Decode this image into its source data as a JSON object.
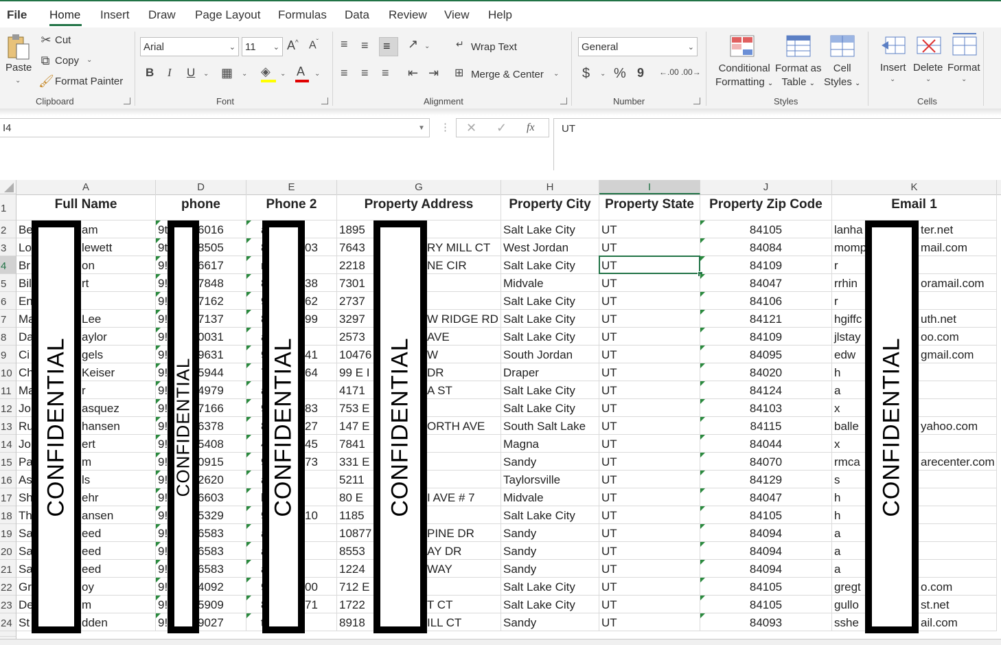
{
  "tabs": [
    "File",
    "Home",
    "Insert",
    "Draw",
    "Page Layout",
    "Formulas",
    "Data",
    "Review",
    "View",
    "Help"
  ],
  "ribbon": {
    "clipboard": {
      "paste": "Paste",
      "cut": "Cut",
      "copy": "Copy",
      "format_painter": "Format Painter",
      "label": "Clipboard"
    },
    "font": {
      "name": "Arial",
      "size": "11",
      "label": "Font",
      "bold": "B",
      "italic": "I",
      "underline": "U",
      "grow": "A",
      "shrink": "A"
    },
    "alignment": {
      "wrap_text": "Wrap Text",
      "merge_center": "Merge & Center",
      "label": "Alignment"
    },
    "number": {
      "format": "General",
      "label": "Number",
      "currency": "$",
      "percent": "%",
      "comma": "9",
      "inc_decimal": ".00",
      "dec_decimal": ".00"
    },
    "styles": {
      "conditional_formatting": [
        "Conditional",
        "Formatting"
      ],
      "format_as_table": [
        "Format as",
        "Table"
      ],
      "cell_styles": [
        "Cell",
        "Styles"
      ],
      "label": "Styles"
    },
    "cells": {
      "insert": "Insert",
      "delete": "Delete",
      "format": "Format",
      "label": "Cells"
    }
  },
  "formula_bar": {
    "name_box": "I4",
    "fx": "fx",
    "value": "UT"
  },
  "columns": [
    "A",
    "D",
    "E",
    "G",
    "H",
    "I",
    "J",
    "K"
  ],
  "selected_column": "I",
  "selected_row": "4",
  "headers": [
    "Full Name",
    "phone",
    "Phone 2",
    "Property Address",
    "Property City",
    "Property State",
    "Property Zip Code",
    "Email 1"
  ],
  "rows": [
    {
      "n": "2",
      "a1": "Be",
      "a2": "am",
      "d1": "9t",
      "d2": "6016",
      "e1": "a",
      "e2": "",
      "g1": "1895",
      "g2": "",
      "city": "Salt Lake City",
      "state": "UT",
      "zip": "84105",
      "k1": "lanha",
      "k2": "ter.net"
    },
    {
      "n": "3",
      "a1": "Lo",
      "a2": "lewett",
      "d1": "9t",
      "d2": "8505",
      "e1": "80",
      "e2": "03",
      "g1": "7643",
      "g2": "RY MILL CT",
      "city": "West Jordan",
      "state": "UT",
      "zip": "84084",
      "k1": "momp",
      "k2": "mail.com"
    },
    {
      "n": "4",
      "a1": "Br",
      "a2": "on",
      "d1": "9!",
      "d2": "6617",
      "e1": "r",
      "e2": "",
      "g1": "2218",
      "g2": "NE CIR",
      "city": "Salt Lake City",
      "state": "UT",
      "zip": "84109",
      "k1": "r",
      "k2": ""
    },
    {
      "n": "5",
      "a1": "Bil",
      "a2": "rt",
      "d1": "9!",
      "d2": "7848",
      "e1": "80",
      "e2": "38",
      "g1": "7301",
      "g2": "",
      "city": "Midvale",
      "state": "UT",
      "zip": "84047",
      "k1": "rrhin",
      "k2": "oramail.com"
    },
    {
      "n": "6",
      "a1": "En",
      "a2": "",
      "d1": "9!",
      "d2": "7162",
      "e1": "97",
      "e2": "62",
      "g1": "2737",
      "g2": "",
      "city": "Salt Lake City",
      "state": "UT",
      "zip": "84106",
      "k1": "r",
      "k2": ""
    },
    {
      "n": "7",
      "a1": "Ma",
      "a2": "Lee",
      "d1": "9!",
      "d2": "7137",
      "e1": "81",
      "e2": "99",
      "g1": "3297",
      "g2": "W RIDGE RD",
      "city": "Salt Lake City",
      "state": "UT",
      "zip": "84121",
      "k1": "hgiffc",
      "k2": "uth.net"
    },
    {
      "n": "8",
      "a1": "Da",
      "a2": "aylor",
      "d1": "9!",
      "d2": "0031",
      "e1": "a",
      "e2": "",
      "g1": "2573",
      "g2": "AVE",
      "city": "Salt Lake City",
      "state": "UT",
      "zip": "84109",
      "k1": "jlstay",
      "k2": "oo.com"
    },
    {
      "n": "9",
      "a1": "Ci",
      "a2": "gels",
      "d1": "9!",
      "d2": "9631",
      "e1": "97",
      "e2": "41",
      "g1": "10476",
      "g2": "W",
      "city": "South Jordan",
      "state": "UT",
      "zip": "84095",
      "k1": "edw",
      "k2": "gmail.com"
    },
    {
      "n": "10",
      "a1": "Ch",
      "a2": "Keiser",
      "d1": "9!",
      "d2": "5944",
      "e1": "75",
      "e2": "64",
      "g1": "99 E I",
      "g2": "DR",
      "city": "Draper",
      "state": "UT",
      "zip": "84020",
      "k1": "h",
      "k2": ""
    },
    {
      "n": "11",
      "a1": "Ma",
      "a2": "r",
      "d1": "9!",
      "d2": "4979",
      "e1": "a",
      "e2": "",
      "g1": "4171",
      "g2": "A ST",
      "city": "Salt Lake City",
      "state": "UT",
      "zip": "84124",
      "k1": "a",
      "k2": ""
    },
    {
      "n": "12",
      "a1": "Jo",
      "a2": "asquez",
      "d1": "9!",
      "d2": "7166",
      "e1": "94",
      "e2": "83",
      "g1": "753 E",
      "g2": "",
      "city": "Salt Lake City",
      "state": "UT",
      "zip": "84103",
      "k1": "x",
      "k2": ""
    },
    {
      "n": "13",
      "a1": "Ru",
      "a2": "hansen",
      "d1": "9!",
      "d2": "6378",
      "e1": "80",
      "e2": "27",
      "g1": "147 E",
      "g2": "ORTH AVE",
      "city": "South Salt Lake",
      "state": "UT",
      "zip": "84115",
      "k1": "balle",
      "k2": "yahoo.com"
    },
    {
      "n": "14",
      "a1": "Jo",
      "a2": "ert",
      "d1": "9!",
      "d2": "5408",
      "e1": "48",
      "e2": "45",
      "g1": "7841",
      "g2": "",
      "city": "Magna",
      "state": "UT",
      "zip": "84044",
      "k1": "x",
      "k2": ""
    },
    {
      "n": "15",
      "a1": "Pa",
      "a2": "m",
      "d1": "9!",
      "d2": "0915",
      "e1": "92",
      "e2": "73",
      "g1": "331 E",
      "g2": "",
      "city": "Sandy",
      "state": "UT",
      "zip": "84070",
      "k1": "rmca",
      "k2": "arecenter.com"
    },
    {
      "n": "16",
      "a1": "As",
      "a2": "ls",
      "d1": "9!",
      "d2": "2620",
      "e1": "a",
      "e2": "",
      "g1": "5211",
      "g2": "",
      "city": "Taylorsville",
      "state": "UT",
      "zip": "84129",
      "k1": "s",
      "k2": ""
    },
    {
      "n": "17",
      "a1": "Sh",
      "a2": "ehr",
      "d1": "9!",
      "d2": "6603",
      "e1": "h",
      "e2": "",
      "g1": "80 E",
      "g2": "I AVE # 7",
      "city": "Midvale",
      "state": "UT",
      "zip": "84047",
      "k1": "h",
      "k2": ""
    },
    {
      "n": "18",
      "a1": "Th",
      "a2": "ansen",
      "d1": "9!",
      "d2": "5329",
      "e1": "92",
      "e2": "10",
      "g1": "1185",
      "g2": "",
      "city": "Salt Lake City",
      "state": "UT",
      "zip": "84105",
      "k1": "h",
      "k2": ""
    },
    {
      "n": "19",
      "a1": "Sa",
      "a2": "eed",
      "d1": "9!",
      "d2": "6583",
      "e1": "a",
      "e2": "",
      "g1": "10877",
      "g2": "PINE DR",
      "city": "Sandy",
      "state": "UT",
      "zip": "84094",
      "k1": "a",
      "k2": ""
    },
    {
      "n": "20",
      "a1": "Sa",
      "a2": "eed",
      "d1": "9!",
      "d2": "6583",
      "e1": "a",
      "e2": "",
      "g1": "8553",
      "g2": "AY DR",
      "city": "Sandy",
      "state": "UT",
      "zip": "84094",
      "k1": "a",
      "k2": ""
    },
    {
      "n": "21",
      "a1": "Sa",
      "a2": "eed",
      "d1": "9!",
      "d2": "6583",
      "e1": "a",
      "e2": "",
      "g1": "1224",
      "g2": "WAY",
      "city": "Sandy",
      "state": "UT",
      "zip": "84094",
      "k1": "a",
      "k2": ""
    },
    {
      "n": "22",
      "a1": "Gr",
      "a2": "oy",
      "d1": "9!",
      "d2": "4092",
      "e1": "92",
      "e2": "00",
      "g1": "712 E",
      "g2": "",
      "city": "Salt Lake City",
      "state": "UT",
      "zip": "84105",
      "k1": "gregt",
      "k2": "o.com"
    },
    {
      "n": "23",
      "a1": "De",
      "a2": "m",
      "d1": "9!",
      "d2": "5909",
      "e1": "80",
      "e2": "71",
      "g1": "1722",
      "g2": "T CT",
      "city": "Salt Lake City",
      "state": "UT",
      "zip": "84105",
      "k1": "gullo",
      "k2": "st.net"
    },
    {
      "n": "24",
      "a1": "St",
      "a2": "dden",
      "d1": "9!",
      "d2": "9027",
      "e1": "t",
      "e2": "",
      "g1": "8918",
      "g2": "ILL CT",
      "city": "Sandy",
      "state": "UT",
      "zip": "84093",
      "k1": "sshe",
      "k2": "ail.com"
    }
  ],
  "redaction_text": "CONFIDENTIAL"
}
